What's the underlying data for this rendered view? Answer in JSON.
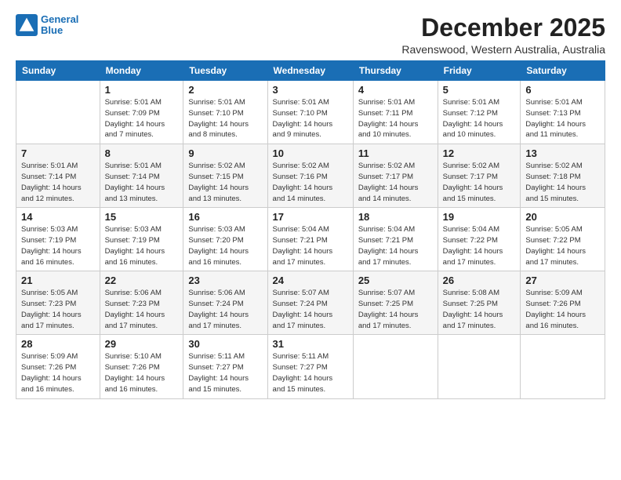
{
  "logo": {
    "line1": "General",
    "line2": "Blue"
  },
  "title": "December 2025",
  "subtitle": "Ravenswood, Western Australia, Australia",
  "header": {
    "days": [
      "Sunday",
      "Monday",
      "Tuesday",
      "Wednesday",
      "Thursday",
      "Friday",
      "Saturday"
    ]
  },
  "weeks": [
    [
      {
        "day": "",
        "info": ""
      },
      {
        "day": "1",
        "info": "Sunrise: 5:01 AM\nSunset: 7:09 PM\nDaylight: 14 hours\nand 7 minutes."
      },
      {
        "day": "2",
        "info": "Sunrise: 5:01 AM\nSunset: 7:10 PM\nDaylight: 14 hours\nand 8 minutes."
      },
      {
        "day": "3",
        "info": "Sunrise: 5:01 AM\nSunset: 7:10 PM\nDaylight: 14 hours\nand 9 minutes."
      },
      {
        "day": "4",
        "info": "Sunrise: 5:01 AM\nSunset: 7:11 PM\nDaylight: 14 hours\nand 10 minutes."
      },
      {
        "day": "5",
        "info": "Sunrise: 5:01 AM\nSunset: 7:12 PM\nDaylight: 14 hours\nand 10 minutes."
      },
      {
        "day": "6",
        "info": "Sunrise: 5:01 AM\nSunset: 7:13 PM\nDaylight: 14 hours\nand 11 minutes."
      }
    ],
    [
      {
        "day": "7",
        "info": "Sunrise: 5:01 AM\nSunset: 7:14 PM\nDaylight: 14 hours\nand 12 minutes."
      },
      {
        "day": "8",
        "info": "Sunrise: 5:01 AM\nSunset: 7:14 PM\nDaylight: 14 hours\nand 13 minutes."
      },
      {
        "day": "9",
        "info": "Sunrise: 5:02 AM\nSunset: 7:15 PM\nDaylight: 14 hours\nand 13 minutes."
      },
      {
        "day": "10",
        "info": "Sunrise: 5:02 AM\nSunset: 7:16 PM\nDaylight: 14 hours\nand 14 minutes."
      },
      {
        "day": "11",
        "info": "Sunrise: 5:02 AM\nSunset: 7:17 PM\nDaylight: 14 hours\nand 14 minutes."
      },
      {
        "day": "12",
        "info": "Sunrise: 5:02 AM\nSunset: 7:17 PM\nDaylight: 14 hours\nand 15 minutes."
      },
      {
        "day": "13",
        "info": "Sunrise: 5:02 AM\nSunset: 7:18 PM\nDaylight: 14 hours\nand 15 minutes."
      }
    ],
    [
      {
        "day": "14",
        "info": "Sunrise: 5:03 AM\nSunset: 7:19 PM\nDaylight: 14 hours\nand 16 minutes."
      },
      {
        "day": "15",
        "info": "Sunrise: 5:03 AM\nSunset: 7:19 PM\nDaylight: 14 hours\nand 16 minutes."
      },
      {
        "day": "16",
        "info": "Sunrise: 5:03 AM\nSunset: 7:20 PM\nDaylight: 14 hours\nand 16 minutes."
      },
      {
        "day": "17",
        "info": "Sunrise: 5:04 AM\nSunset: 7:21 PM\nDaylight: 14 hours\nand 17 minutes."
      },
      {
        "day": "18",
        "info": "Sunrise: 5:04 AM\nSunset: 7:21 PM\nDaylight: 14 hours\nand 17 minutes."
      },
      {
        "day": "19",
        "info": "Sunrise: 5:04 AM\nSunset: 7:22 PM\nDaylight: 14 hours\nand 17 minutes."
      },
      {
        "day": "20",
        "info": "Sunrise: 5:05 AM\nSunset: 7:22 PM\nDaylight: 14 hours\nand 17 minutes."
      }
    ],
    [
      {
        "day": "21",
        "info": "Sunrise: 5:05 AM\nSunset: 7:23 PM\nDaylight: 14 hours\nand 17 minutes."
      },
      {
        "day": "22",
        "info": "Sunrise: 5:06 AM\nSunset: 7:23 PM\nDaylight: 14 hours\nand 17 minutes."
      },
      {
        "day": "23",
        "info": "Sunrise: 5:06 AM\nSunset: 7:24 PM\nDaylight: 14 hours\nand 17 minutes."
      },
      {
        "day": "24",
        "info": "Sunrise: 5:07 AM\nSunset: 7:24 PM\nDaylight: 14 hours\nand 17 minutes."
      },
      {
        "day": "25",
        "info": "Sunrise: 5:07 AM\nSunset: 7:25 PM\nDaylight: 14 hours\nand 17 minutes."
      },
      {
        "day": "26",
        "info": "Sunrise: 5:08 AM\nSunset: 7:25 PM\nDaylight: 14 hours\nand 17 minutes."
      },
      {
        "day": "27",
        "info": "Sunrise: 5:09 AM\nSunset: 7:26 PM\nDaylight: 14 hours\nand 16 minutes."
      }
    ],
    [
      {
        "day": "28",
        "info": "Sunrise: 5:09 AM\nSunset: 7:26 PM\nDaylight: 14 hours\nand 16 minutes."
      },
      {
        "day": "29",
        "info": "Sunrise: 5:10 AM\nSunset: 7:26 PM\nDaylight: 14 hours\nand 16 minutes."
      },
      {
        "day": "30",
        "info": "Sunrise: 5:11 AM\nSunset: 7:27 PM\nDaylight: 14 hours\nand 15 minutes."
      },
      {
        "day": "31",
        "info": "Sunrise: 5:11 AM\nSunset: 7:27 PM\nDaylight: 14 hours\nand 15 minutes."
      },
      {
        "day": "",
        "info": ""
      },
      {
        "day": "",
        "info": ""
      },
      {
        "day": "",
        "info": ""
      }
    ]
  ]
}
